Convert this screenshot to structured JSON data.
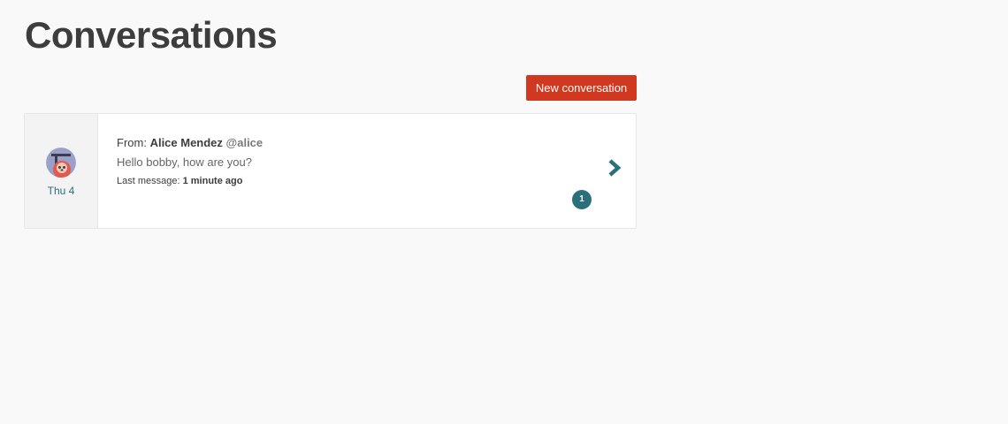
{
  "page": {
    "title": "Conversations"
  },
  "toolbar": {
    "new_conversation_label": "New conversation"
  },
  "conversations": [
    {
      "date": "Thu 4",
      "from_prefix": "From: ",
      "from_name": "Alice Mendez",
      "from_handle": "@alice",
      "preview": "Hello bobby, how are you?",
      "last_message_prefix": "Last message: ",
      "last_message_time": "1 minute ago",
      "unread_count": "1",
      "avatar_icon": "sloth-avatar-icon"
    }
  ],
  "colors": {
    "accent_red": "#d0391f",
    "accent_teal": "#2a6f7a",
    "background": "#f9f9f9"
  }
}
